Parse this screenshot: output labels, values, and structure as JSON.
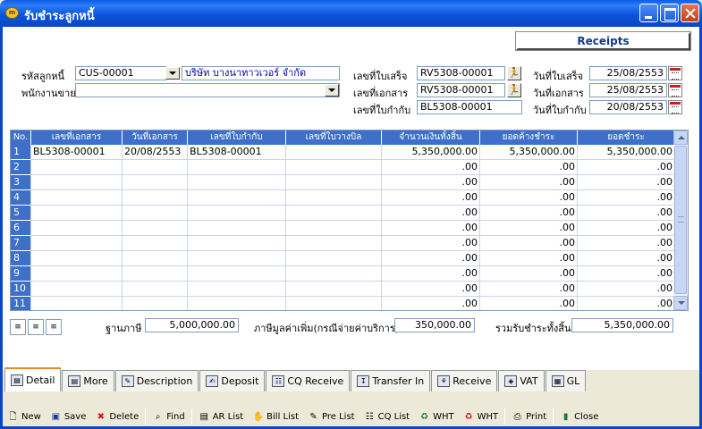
{
  "window": {
    "title": "รับชำระลูกหนี้",
    "icon": "app-icon"
  },
  "header_box": "Receipts",
  "form": {
    "customer_label": "รหัสลูกหนี้",
    "customer_code": "CUS-00001",
    "customer_name": "บริษัท บางนาทาวเวอร์ จำกัด",
    "salesman_label": "พนักงานขาย",
    "salesman_value": "",
    "receipt_no_label": "เลขที่ใบเสร็จ",
    "receipt_no": "RV5308-00001",
    "doc_no_label": "เลขที่เอกสาร",
    "doc_no": "RV5308-00001",
    "bill_no_label": "เลขที่ใบกำกับ",
    "bill_no": "BL5308-00001",
    "receipt_date_label": "วันที่ใบเสร็จ",
    "receipt_date": "25/08/2553",
    "doc_date_label": "วันที่เอกสาร",
    "doc_date": "25/08/2553",
    "bill_date_label": "วันที่ใบกำกับ",
    "bill_date": "20/08/2553"
  },
  "grid": {
    "columns": [
      "No.",
      "เลขที่เอกสาร",
      "วันที่เอกสาร",
      "เลขที่ใบกำกับ",
      "เลขที่ใบวางบิล",
      "จำนวนเงินทั้งสิ้น",
      "ยอดค้างชำระ",
      "ยอดชำระ"
    ],
    "rows": [
      [
        "1",
        "BL5308-00001",
        "20/08/2553",
        "BL5308-00001",
        "",
        "5,350,000.00",
        "5,350,000.00",
        "5,350,000.00"
      ],
      [
        "2",
        "",
        "",
        "",
        "",
        ".00",
        ".00",
        ".00"
      ],
      [
        "3",
        "",
        "",
        "",
        "",
        ".00",
        ".00",
        ".00"
      ],
      [
        "4",
        "",
        "",
        "",
        "",
        ".00",
        ".00",
        ".00"
      ],
      [
        "5",
        "",
        "",
        "",
        "",
        ".00",
        ".00",
        ".00"
      ],
      [
        "6",
        "",
        "",
        "",
        "",
        ".00",
        ".00",
        ".00"
      ],
      [
        "7",
        "",
        "",
        "",
        "",
        ".00",
        ".00",
        ".00"
      ],
      [
        "8",
        "",
        "",
        "",
        "",
        ".00",
        ".00",
        ".00"
      ],
      [
        "9",
        "",
        "",
        "",
        "",
        ".00",
        ".00",
        ".00"
      ],
      [
        "10",
        "",
        "",
        "",
        "",
        ".00",
        ".00",
        ".00"
      ],
      [
        "11",
        "",
        "",
        "",
        "",
        ".00",
        ".00",
        ".00"
      ]
    ]
  },
  "totals": {
    "tax_base_label": "ฐานภาษี",
    "tax_base": "5,000,000.00",
    "vat_label": "ภาษีมูลค่าเพิ่ม(กรณีจ่ายค่าบริการ)",
    "vat": "350,000.00",
    "total_label": "รวมรับชำระทั้งสิ้น",
    "total": "5,350,000.00"
  },
  "tabs": [
    "Detail",
    "More",
    "Description",
    "Deposit",
    "CQ Receive",
    "Transfer In",
    "Receive",
    "VAT",
    "GL"
  ],
  "toolbar": [
    "New",
    "Save",
    "Delete",
    "Find",
    "AR List",
    "Bill List",
    "Pre List",
    "CQ List",
    "WHT",
    "WHT",
    "Print",
    "Close"
  ],
  "colors": {
    "titlebar": "#0B55DA",
    "grid_header": "#3E6FC9",
    "active_tab_accent": "#E68B2C"
  }
}
